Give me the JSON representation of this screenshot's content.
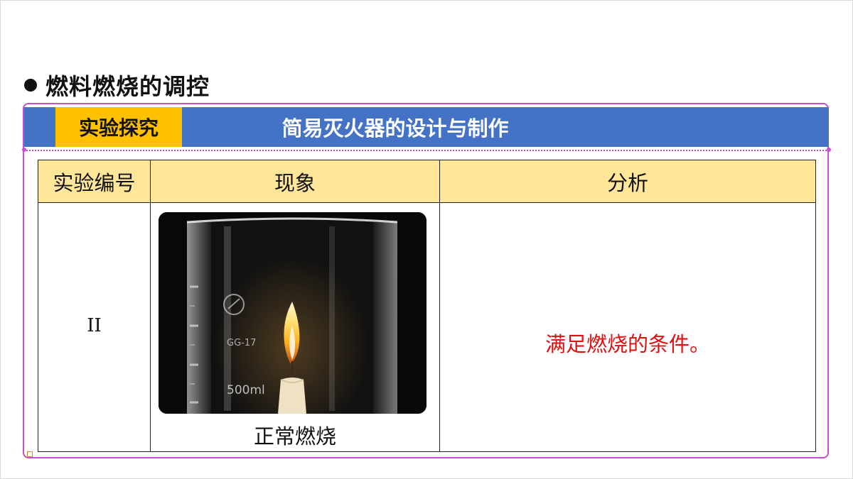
{
  "heading": {
    "text": "燃料燃烧的调控"
  },
  "banner": {
    "tag": "实验探究",
    "title": "简易灭火器的设计与制作",
    "bar_color": "#4472c4",
    "tag_color": "#ffc000"
  },
  "table": {
    "headers": [
      "实验编号",
      "现象",
      "分析"
    ],
    "header_bg": "#ffe699",
    "rows": [
      {
        "number": "II",
        "phenomenon_caption": "正常燃烧",
        "analysis": "满足燃烧的条件。"
      }
    ]
  },
  "photo": {
    "beaker_markings": [
      "GG-17",
      "500ml"
    ]
  },
  "colors": {
    "frame": "#c74ecf",
    "analysis_text": "#e01010"
  }
}
